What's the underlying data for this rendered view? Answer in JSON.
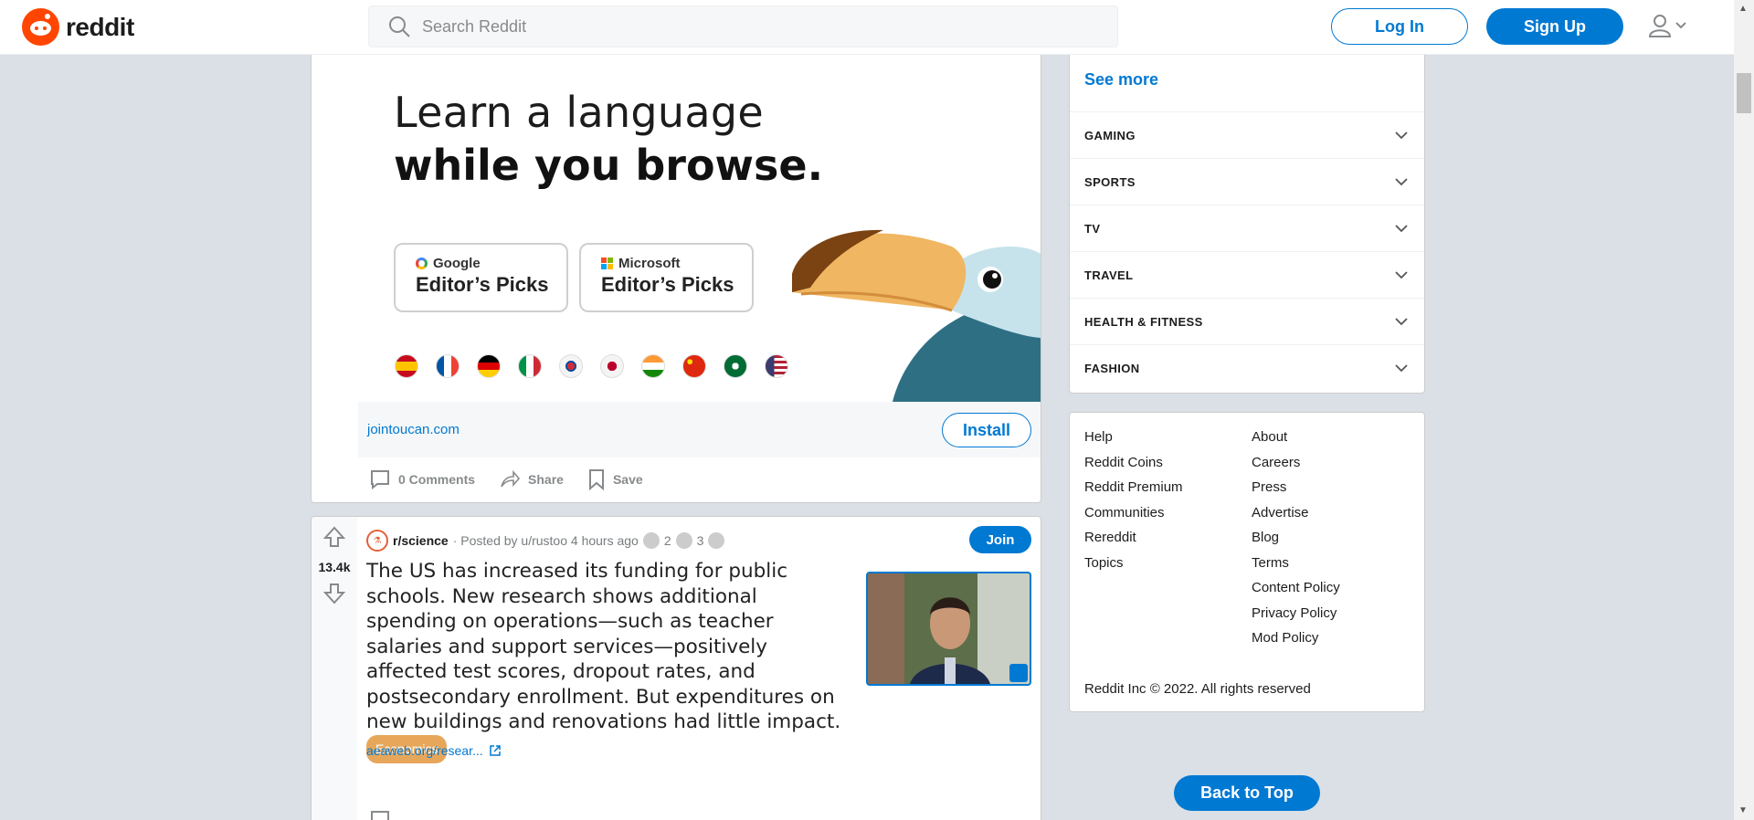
{
  "header": {
    "logo_text": "reddit",
    "search_placeholder": "Search Reddit",
    "login_label": "Log In",
    "signup_label": "Sign Up"
  },
  "ad": {
    "headline_line1": "Learn a language",
    "headline_line2": "while you browse.",
    "badges": [
      {
        "brand": "Google",
        "label": "Editor’s Picks"
      },
      {
        "brand": "Microsoft",
        "label": "Editor’s Picks"
      }
    ],
    "link": "jointoucan.com",
    "install_label": "Install",
    "actions": {
      "comments": "0 Comments",
      "share": "Share",
      "save": "Save"
    }
  },
  "post": {
    "votes": "13.4k",
    "subreddit": "r/science",
    "posted_by": "· Posted by u/rustoo 4 hours ago",
    "award1_count": "2",
    "award2_count": "3",
    "join_label": "Join",
    "title": "The US has increased its funding for public schools. New research shows additional spending on operations—such as teacher salaries and support services—positively affected test scores, dropout rates, and postsecondary enrollment. But expenditures on new buildings and renovations had little impact.",
    "flair": "Economics",
    "link": "aeaweb.org/resear..."
  },
  "sidebar": {
    "see_more": "See more",
    "topics": [
      "GAMING",
      "SPORTS",
      "TV",
      "TRAVEL",
      "HEALTH & FITNESS",
      "FASHION"
    ],
    "links_left": [
      "Help",
      "Reddit Coins",
      "Reddit Premium",
      "Communities",
      "Rereddit",
      "Topics"
    ],
    "links_right": [
      "About",
      "Careers",
      "Press",
      "Advertise",
      "Blog",
      "Terms",
      "Content Policy",
      "Privacy Policy",
      "Mod Policy"
    ],
    "copyright": "Reddit Inc © 2022. All rights reserved",
    "back_to_top": "Back to Top"
  },
  "colors": {
    "brand": "#ff4500",
    "accent": "#0079d3",
    "flair": "#e7a75b",
    "background": "#dae0e6"
  }
}
